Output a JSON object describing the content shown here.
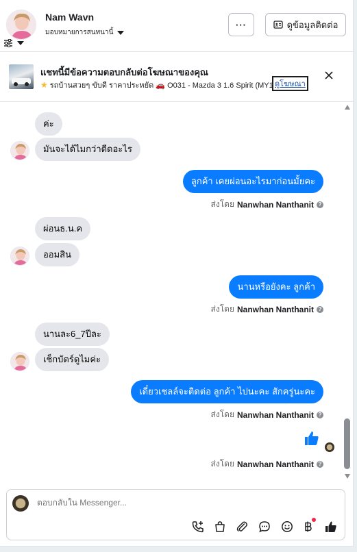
{
  "header": {
    "contact_name": "Nam Wavn",
    "assign_label": "มอบหมายการสนทนานี้",
    "more_label": "···",
    "contact_info_label": "ดูข้อมูลติดต่อ"
  },
  "ad_banner": {
    "title": "แชทนี้มีข้อความตอบกลับต่อโฆษณาของคุณ",
    "subtitle": "รถบ้านสวยๆ ขับดี ราคาประหยัด 🚗 O031 - Mazda 3 1.6 Spirit (MY1...",
    "view_ad_label": "ดูโฆษณา"
  },
  "messages": [
    {
      "side": "in",
      "text": "ค่ะ",
      "avatar": false
    },
    {
      "side": "in",
      "text": "มันจะได้ไมกว่าดีดอะไร",
      "avatar": true
    },
    {
      "side": "out",
      "text": "ลูกค้า เคยผ่อนอะไรมาก่อนมั้ยคะ",
      "sent_by_prefix": "ส่งโดย",
      "sent_by_name": "Nanwhan Nanthanit"
    },
    {
      "side": "in",
      "text": "ผ่อนธ.น.ค",
      "avatar": false
    },
    {
      "side": "in",
      "text": "ออมสิน",
      "avatar": true
    },
    {
      "side": "out",
      "text": "นานหรือยังคะ  ลูกค้า",
      "sent_by_prefix": "ส่งโดย",
      "sent_by_name": "Nanwhan Nanthanit"
    },
    {
      "side": "in",
      "text": "นานละ6_7ปีละ",
      "avatar": false
    },
    {
      "side": "in",
      "text": "เช็กบัตร์ดูไมค่ะ",
      "avatar": true
    },
    {
      "side": "out",
      "text": "เดี๋ยวเชลล์จะติดต่อ ลูกค้า ไปนะคะ  สักครู่นะคะ",
      "sent_by_prefix": "ส่งโดย",
      "sent_by_name": "Nanwhan Nanthanit"
    },
    {
      "side": "out_like",
      "text": "👍",
      "sent_by_prefix": "ส่งโดย",
      "sent_by_name": "Nanwhan Nanthanit"
    }
  ],
  "composer": {
    "placeholder": "ตอบกลับใน Messenger..."
  },
  "colors": {
    "accent": "#0a7cff",
    "incoming_bubble": "#e4e6eb",
    "notification_dot": "#f02849"
  },
  "icons": [
    "filter-icon",
    "more-icon",
    "contact-card-icon",
    "close-icon",
    "info-icon",
    "like-icon",
    "phone-add-icon",
    "shopping-bag-icon",
    "paperclip-icon",
    "chat-bubble-icon",
    "emoji-icon",
    "baht-icon",
    "thumbs-up-icon"
  ]
}
